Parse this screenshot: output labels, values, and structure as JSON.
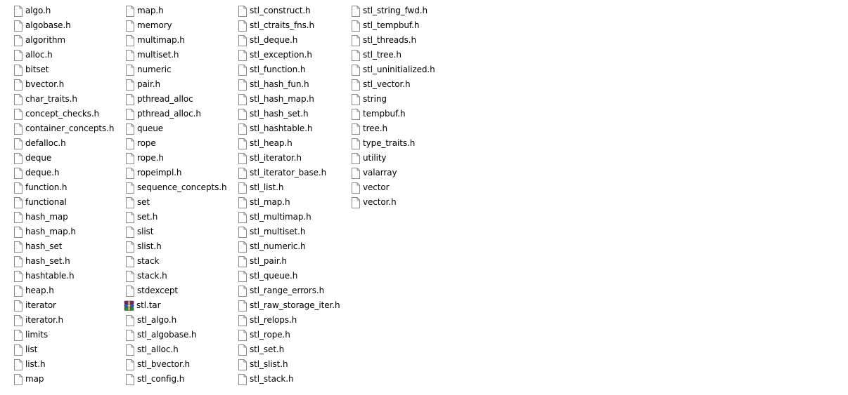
{
  "columns": [
    [
      {
        "name": "algo.h",
        "icon": "generic-file-icon"
      },
      {
        "name": "algobase.h",
        "icon": "generic-file-icon"
      },
      {
        "name": "algorithm",
        "icon": "generic-file-icon"
      },
      {
        "name": "alloc.h",
        "icon": "generic-file-icon"
      },
      {
        "name": "bitset",
        "icon": "generic-file-icon"
      },
      {
        "name": "bvector.h",
        "icon": "generic-file-icon"
      },
      {
        "name": "char_traits.h",
        "icon": "generic-file-icon"
      },
      {
        "name": "concept_checks.h",
        "icon": "generic-file-icon"
      },
      {
        "name": "container_concepts.h",
        "icon": "generic-file-icon"
      },
      {
        "name": "defalloc.h",
        "icon": "generic-file-icon"
      },
      {
        "name": "deque",
        "icon": "generic-file-icon"
      },
      {
        "name": "deque.h",
        "icon": "generic-file-icon"
      },
      {
        "name": "function.h",
        "icon": "generic-file-icon"
      },
      {
        "name": "functional",
        "icon": "generic-file-icon"
      },
      {
        "name": "hash_map",
        "icon": "generic-file-icon"
      },
      {
        "name": "hash_map.h",
        "icon": "generic-file-icon"
      },
      {
        "name": "hash_set",
        "icon": "generic-file-icon"
      },
      {
        "name": "hash_set.h",
        "icon": "generic-file-icon"
      },
      {
        "name": "hashtable.h",
        "icon": "generic-file-icon"
      },
      {
        "name": "heap.h",
        "icon": "generic-file-icon"
      },
      {
        "name": "iterator",
        "icon": "generic-file-icon"
      },
      {
        "name": "iterator.h",
        "icon": "generic-file-icon"
      },
      {
        "name": "limits",
        "icon": "generic-file-icon"
      },
      {
        "name": "list",
        "icon": "generic-file-icon"
      },
      {
        "name": "list.h",
        "icon": "generic-file-icon"
      },
      {
        "name": "map",
        "icon": "generic-file-icon"
      }
    ],
    [
      {
        "name": "map.h",
        "icon": "generic-file-icon"
      },
      {
        "name": "memory",
        "icon": "generic-file-icon"
      },
      {
        "name": "multimap.h",
        "icon": "generic-file-icon"
      },
      {
        "name": "multiset.h",
        "icon": "generic-file-icon"
      },
      {
        "name": "numeric",
        "icon": "generic-file-icon"
      },
      {
        "name": "pair.h",
        "icon": "generic-file-icon"
      },
      {
        "name": "pthread_alloc",
        "icon": "generic-file-icon"
      },
      {
        "name": "pthread_alloc.h",
        "icon": "generic-file-icon"
      },
      {
        "name": "queue",
        "icon": "generic-file-icon"
      },
      {
        "name": "rope",
        "icon": "generic-file-icon"
      },
      {
        "name": "rope.h",
        "icon": "generic-file-icon"
      },
      {
        "name": "ropeimpl.h",
        "icon": "generic-file-icon"
      },
      {
        "name": "sequence_concepts.h",
        "icon": "generic-file-icon"
      },
      {
        "name": "set",
        "icon": "generic-file-icon"
      },
      {
        "name": "set.h",
        "icon": "generic-file-icon"
      },
      {
        "name": "slist",
        "icon": "generic-file-icon"
      },
      {
        "name": "slist.h",
        "icon": "generic-file-icon"
      },
      {
        "name": "stack",
        "icon": "generic-file-icon"
      },
      {
        "name": "stack.h",
        "icon": "generic-file-icon"
      },
      {
        "name": "stdexcept",
        "icon": "generic-file-icon"
      },
      {
        "name": "stl.tar",
        "icon": "archive-icon"
      },
      {
        "name": "stl_algo.h",
        "icon": "generic-file-icon"
      },
      {
        "name": "stl_algobase.h",
        "icon": "generic-file-icon"
      },
      {
        "name": "stl_alloc.h",
        "icon": "generic-file-icon"
      },
      {
        "name": "stl_bvector.h",
        "icon": "generic-file-icon"
      },
      {
        "name": "stl_config.h",
        "icon": "generic-file-icon"
      }
    ],
    [
      {
        "name": "stl_construct.h",
        "icon": "generic-file-icon"
      },
      {
        "name": "stl_ctraits_fns.h",
        "icon": "generic-file-icon"
      },
      {
        "name": "stl_deque.h",
        "icon": "generic-file-icon"
      },
      {
        "name": "stl_exception.h",
        "icon": "generic-file-icon"
      },
      {
        "name": "stl_function.h",
        "icon": "generic-file-icon"
      },
      {
        "name": "stl_hash_fun.h",
        "icon": "generic-file-icon"
      },
      {
        "name": "stl_hash_map.h",
        "icon": "generic-file-icon"
      },
      {
        "name": "stl_hash_set.h",
        "icon": "generic-file-icon"
      },
      {
        "name": "stl_hashtable.h",
        "icon": "generic-file-icon"
      },
      {
        "name": "stl_heap.h",
        "icon": "generic-file-icon"
      },
      {
        "name": "stl_iterator.h",
        "icon": "generic-file-icon"
      },
      {
        "name": "stl_iterator_base.h",
        "icon": "generic-file-icon"
      },
      {
        "name": "stl_list.h",
        "icon": "generic-file-icon"
      },
      {
        "name": "stl_map.h",
        "icon": "generic-file-icon"
      },
      {
        "name": "stl_multimap.h",
        "icon": "generic-file-icon"
      },
      {
        "name": "stl_multiset.h",
        "icon": "generic-file-icon"
      },
      {
        "name": "stl_numeric.h",
        "icon": "generic-file-icon"
      },
      {
        "name": "stl_pair.h",
        "icon": "generic-file-icon"
      },
      {
        "name": "stl_queue.h",
        "icon": "generic-file-icon"
      },
      {
        "name": "stl_range_errors.h",
        "icon": "generic-file-icon"
      },
      {
        "name": "stl_raw_storage_iter.h",
        "icon": "generic-file-icon"
      },
      {
        "name": "stl_relops.h",
        "icon": "generic-file-icon"
      },
      {
        "name": "stl_rope.h",
        "icon": "generic-file-icon"
      },
      {
        "name": "stl_set.h",
        "icon": "generic-file-icon"
      },
      {
        "name": "stl_slist.h",
        "icon": "generic-file-icon"
      },
      {
        "name": "stl_stack.h",
        "icon": "generic-file-icon"
      }
    ],
    [
      {
        "name": "stl_string_fwd.h",
        "icon": "generic-file-icon"
      },
      {
        "name": "stl_tempbuf.h",
        "icon": "generic-file-icon"
      },
      {
        "name": "stl_threads.h",
        "icon": "generic-file-icon"
      },
      {
        "name": "stl_tree.h",
        "icon": "generic-file-icon"
      },
      {
        "name": "stl_uninitialized.h",
        "icon": "generic-file-icon"
      },
      {
        "name": "stl_vector.h",
        "icon": "generic-file-icon"
      },
      {
        "name": "string",
        "icon": "generic-file-icon"
      },
      {
        "name": "tempbuf.h",
        "icon": "generic-file-icon"
      },
      {
        "name": "tree.h",
        "icon": "generic-file-icon"
      },
      {
        "name": "type_traits.h",
        "icon": "generic-file-icon"
      },
      {
        "name": "utility",
        "icon": "generic-file-icon"
      },
      {
        "name": "valarray",
        "icon": "generic-file-icon"
      },
      {
        "name": "vector",
        "icon": "generic-file-icon"
      },
      {
        "name": "vector.h",
        "icon": "generic-file-icon"
      }
    ]
  ],
  "colors": {
    "background": "#ffffff",
    "text": "#000000",
    "file_icon_outline": "#8a8a8a",
    "file_icon_fill": "#ffffff",
    "archive_purple": "#8b1a7a",
    "archive_blue": "#2c5aa8",
    "archive_green": "#2e8b3e"
  }
}
